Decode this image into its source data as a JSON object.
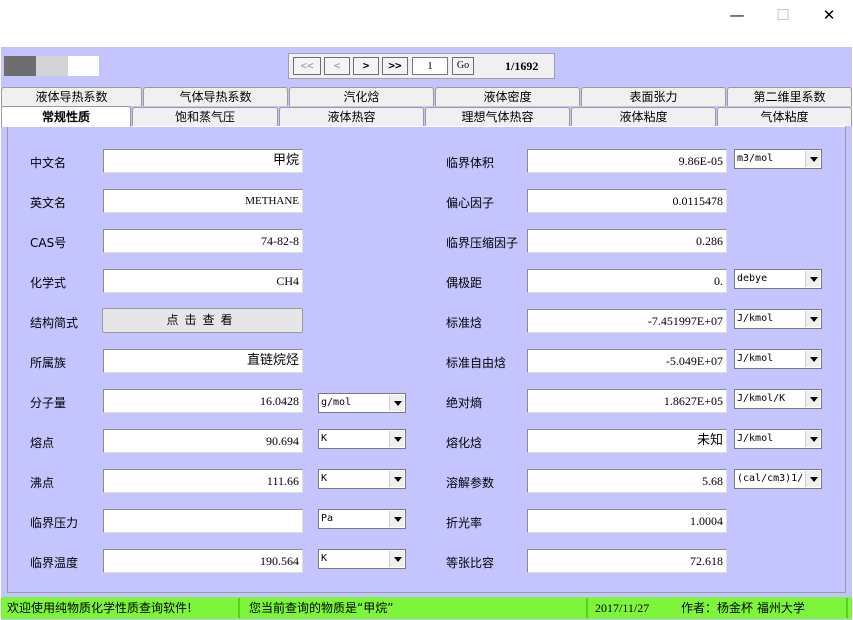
{
  "window": {
    "minimize_glyph": "—",
    "maximize_glyph": "☐",
    "close_glyph": "✕"
  },
  "progress": {
    "filled_fraction": 0.33,
    "partial_fraction": 0.33
  },
  "nav": {
    "first_label": "<<",
    "prev_label": "<",
    "next_label": ">",
    "last_label": ">>",
    "page_value": "1",
    "go_label": "Go",
    "page_info": "1/1692"
  },
  "tabs_row1": [
    "液体导热系数",
    "气体导热系数",
    "汽化焓",
    "液体密度",
    "表面张力",
    "第二维里系数"
  ],
  "tabs_row2": [
    "常规性质",
    "饱和蒸气压",
    "液体热容",
    "理想气体热容",
    "液体粘度",
    "气体粘度"
  ],
  "active_tab": "常规性质",
  "left": {
    "cn_name_label": "中文名",
    "cn_name": "甲烷",
    "en_name_label": "英文名",
    "en_name": "METHANE",
    "cas_label": "CAS号",
    "cas": "74-82-8",
    "formula_label": "化学式",
    "formula": "CH4",
    "structure_label": "结构简式",
    "structure_btn": "点击查看",
    "family_label": "所属族",
    "family": "直链烷烃",
    "mw_label": "分子量",
    "mw": "16.0428",
    "mw_unit": "g/mol",
    "mp_label": "熔点",
    "mp": "90.694",
    "mp_unit": "K",
    "bp_label": "沸点",
    "bp": "111.66",
    "bp_unit": "K",
    "pc_label": "临界压力",
    "pc": "",
    "pc_unit": "Pa",
    "tc_label": "临界温度",
    "tc": "190.564",
    "tc_unit": "K"
  },
  "right": {
    "vc_label": "临界体积",
    "vc": "9.86E-05",
    "vc_unit": "m3/mol",
    "omega_label": "偏心因子",
    "omega": "0.0115478",
    "zc_label": "临界压缩因子",
    "zc": "0.286",
    "dipole_label": "偶极距",
    "dipole": "0.",
    "dipole_unit": "debye",
    "hf_label": "标准焓",
    "hf": "-7.451997E+07",
    "hf_unit": "J/kmol",
    "gf_label": "标准自由焓",
    "gf": "-5.049E+07",
    "gf_unit": "J/kmol",
    "s_label": "绝对熵",
    "s": "1.8627E+05",
    "s_unit": "J/kmol/K",
    "hfus_label": "熔化焓",
    "hfus": "未知",
    "hfus_unit": "J/kmol",
    "sol_label": "溶解参数",
    "sol": "5.68",
    "sol_unit": "(cal/cm3)1/",
    "ri_label": "折光率",
    "ri": "1.0004",
    "parachor_label": "等张比容",
    "parachor": "72.618"
  },
  "status": {
    "welcome": "欢迎使用纯物质化学性质查询软件!",
    "current": "您当前查询的物质是“甲烷”",
    "date": "2017/11/27",
    "author": "作者：杨金杯  福州大学"
  }
}
